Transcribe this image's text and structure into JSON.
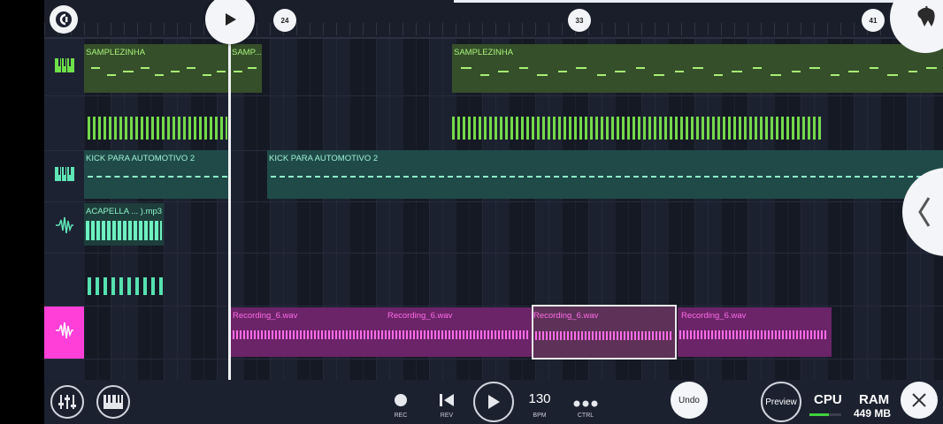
{
  "timeline": {
    "markers": [
      "24",
      "33",
      "41"
    ]
  },
  "tracks": {
    "samplezinha_a": "SAMPLEZINHA",
    "samplezinha_b": "SAMP...",
    "samplezinha_c": "SAMPLEZINHA",
    "kick_a": "KICK PARA AUTOMOTIVO 2",
    "kick_b": "KICK PARA AUTOMOTIVO 2",
    "acapella": "ACAPELLA ... ).mp3",
    "recordings": [
      "Recording_6.wav",
      "Recording_6.wav",
      "Recording_6.wav",
      "Recording_6.wav"
    ]
  },
  "transport": {
    "rec_label": "REC",
    "rev_label": "REV",
    "bpm_value": "130",
    "bpm_label": "BPM",
    "ctrl_label": "CTRL",
    "undo_label": "Undo",
    "preview_label": "Preview"
  },
  "stats": {
    "cpu_label": "CPU",
    "ram_label": "RAM",
    "ram_value": "449 MB",
    "cpu_fraction": 0.6
  },
  "colors": {
    "accent_pink": "#ff3fd8",
    "green": "#6ee04a",
    "teal": "#5fe6b6"
  },
  "icons": [
    "fl-logo-icon",
    "play-icon",
    "fruit-icon",
    "piano-roll-icon",
    "waveform-icon",
    "mixer-icon",
    "piano-icon",
    "record-icon",
    "rewind-icon",
    "more-icon",
    "close-icon",
    "chevron-left-icon"
  ]
}
